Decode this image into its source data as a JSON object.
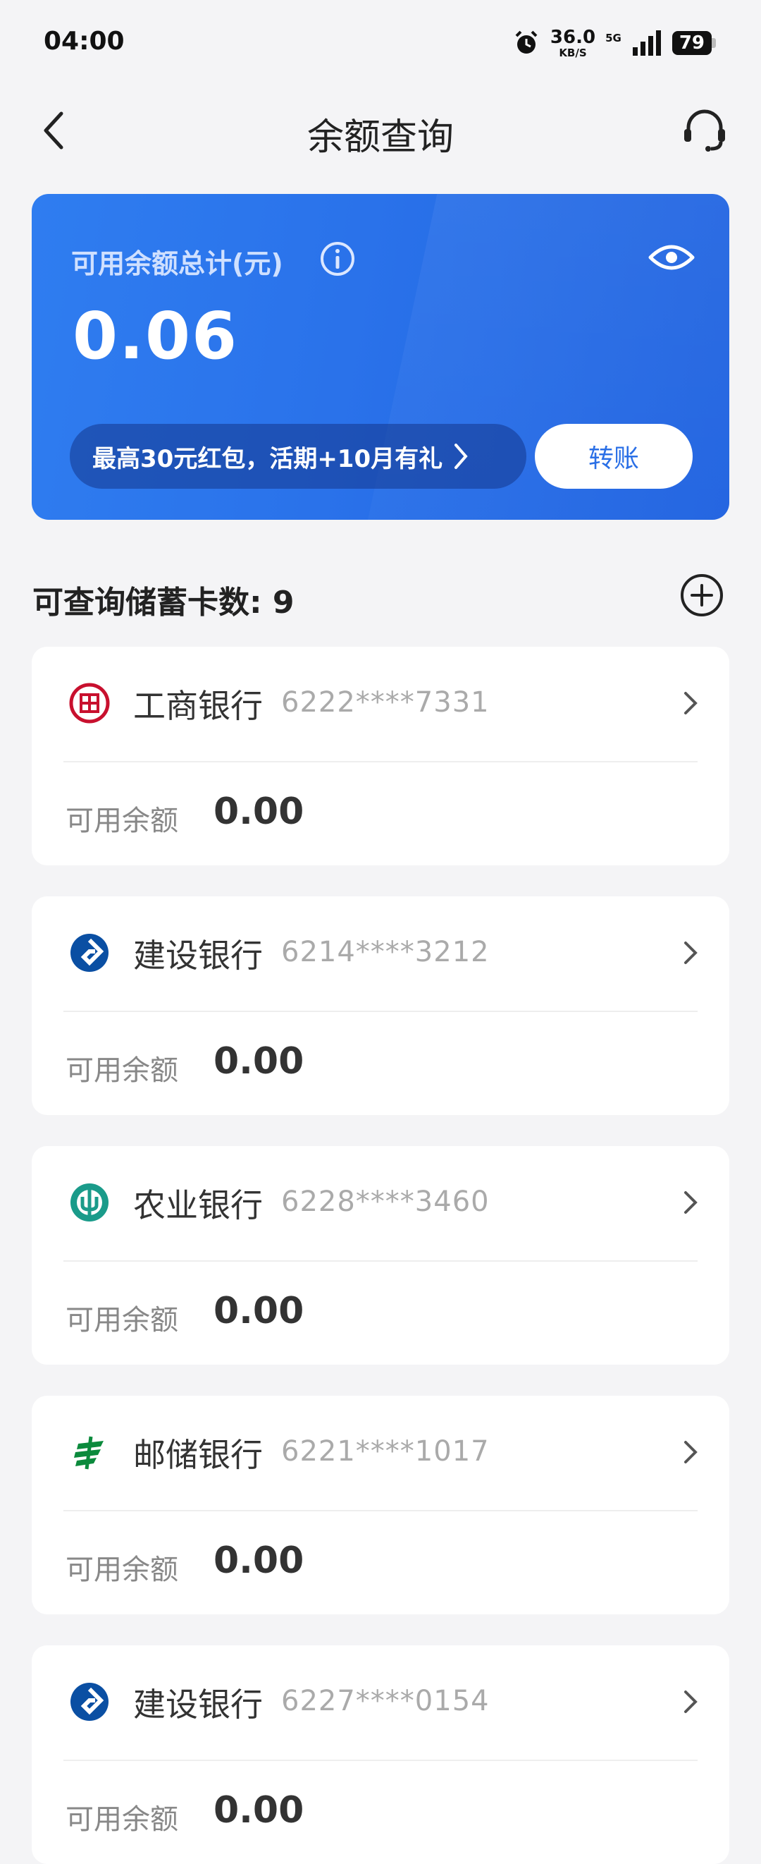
{
  "status": {
    "time": "04:00",
    "net_speed": "36.0",
    "net_unit": "KB/S",
    "net_type": "5G",
    "battery": "79"
  },
  "header": {
    "title": "余额查询",
    "back_icon": "chevron-left-icon",
    "service_icon": "headset-icon"
  },
  "balance": {
    "label": "可用余额总计(元)",
    "amount": "0.06",
    "promo": "最高30元红包，活期+10月有礼",
    "transfer_label": "转账",
    "colors": {
      "card": "#2a72ea",
      "accent": "#2a6fe6"
    }
  },
  "section": {
    "title": "可查询储蓄卡数: 9"
  },
  "cards": [
    {
      "bank": "工商银行",
      "number": "6222****7331",
      "label": "可用余额",
      "balance": "0.00",
      "logo": "icbc-logo-icon",
      "color": "#c8102e"
    },
    {
      "bank": "建设银行",
      "number": "6214****3212",
      "label": "可用余额",
      "balance": "0.00",
      "logo": "ccb-logo-icon",
      "color": "#0a4fa3"
    },
    {
      "bank": "农业银行",
      "number": "6228****3460",
      "label": "可用余额",
      "balance": "0.00",
      "logo": "abc-logo-icon",
      "color": "#1a9b8a"
    },
    {
      "bank": "邮储银行",
      "number": "6221****1017",
      "label": "可用余额",
      "balance": "0.00",
      "logo": "psbc-logo-icon",
      "color": "#0b8a3c"
    },
    {
      "bank": "建设银行",
      "number": "6227****0154",
      "label": "可用余额",
      "balance": "0.00",
      "logo": "ccb-logo-icon",
      "color": "#0a4fa3"
    }
  ]
}
